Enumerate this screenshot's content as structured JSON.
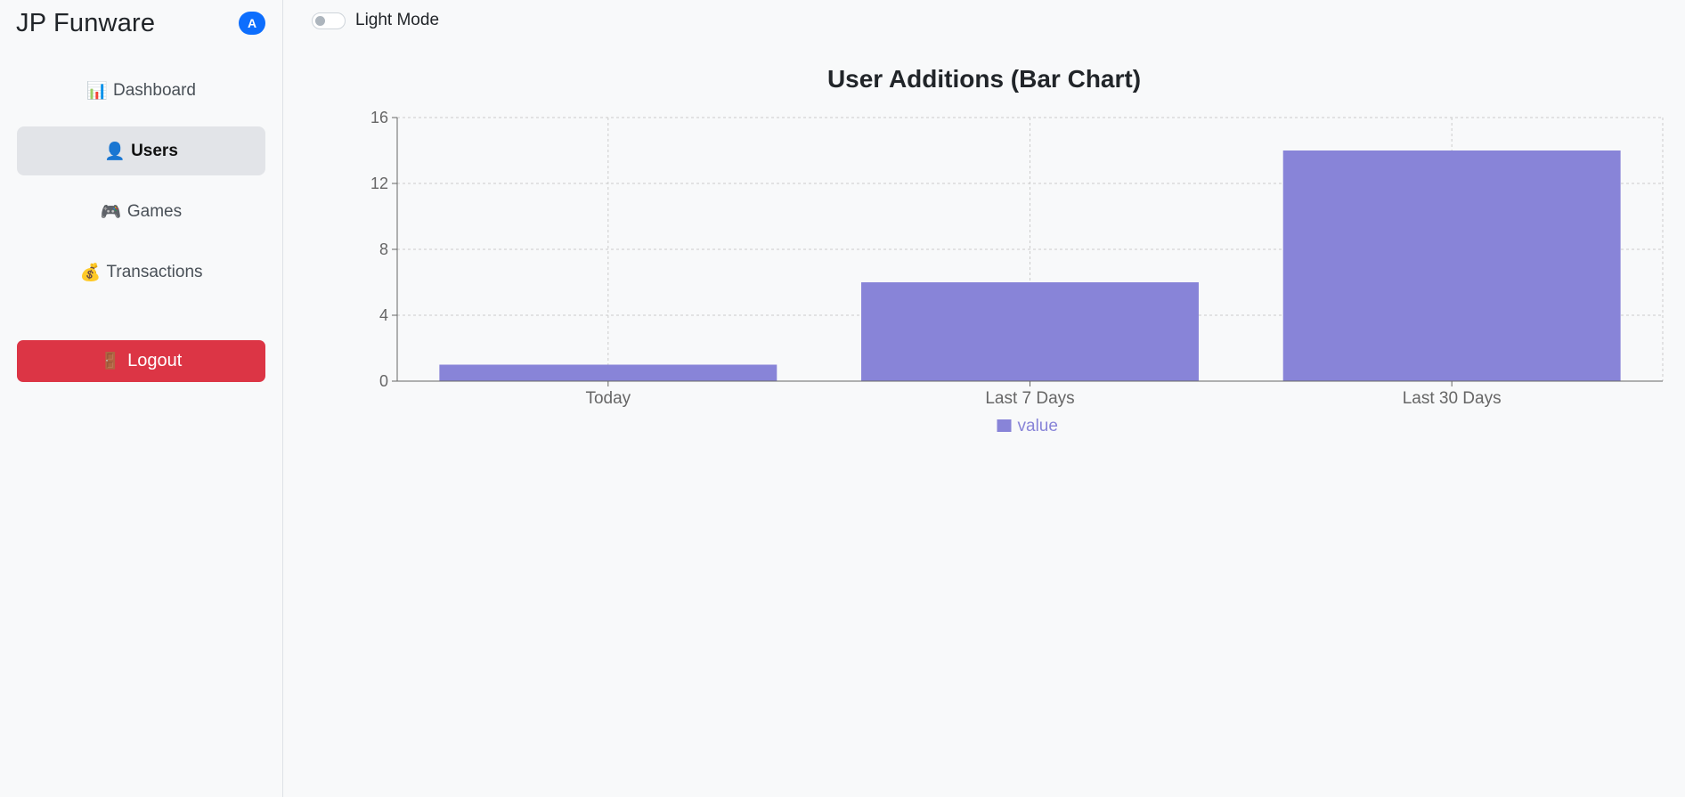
{
  "sidebar": {
    "brand": "JP Funware",
    "avatar_letter": "A",
    "avatar_color": "#0d6efd",
    "items": [
      {
        "icon": "bar-chart-icon",
        "glyph": "📊",
        "label": "Dashboard",
        "active": false
      },
      {
        "icon": "user-icon",
        "glyph": "👤",
        "label": "Users",
        "active": true
      },
      {
        "icon": "gamepad-icon",
        "glyph": "🎮",
        "label": "Games",
        "active": false
      },
      {
        "icon": "money-bag-icon",
        "glyph": "💰",
        "label": "Transactions",
        "active": false
      }
    ],
    "logout": {
      "icon": "door-icon",
      "glyph": "🚪",
      "label": "Logout",
      "color": "#dc3545"
    }
  },
  "header": {
    "theme_toggle_label": "Light Mode",
    "theme_toggle_on": false
  },
  "colors": {
    "bar": "#8884d8",
    "grid": "#cccccc",
    "axis": "#666666"
  },
  "chart_data": {
    "type": "bar",
    "title": "User Additions (Bar Chart)",
    "categories": [
      "Today",
      "Last 7 Days",
      "Last 30 Days"
    ],
    "series": [
      {
        "name": "value",
        "values": [
          1,
          6,
          14
        ]
      }
    ],
    "yticks": [
      0,
      4,
      8,
      12,
      16
    ],
    "ylim": [
      0,
      16
    ],
    "grid": true,
    "legend": "bottom-center"
  }
}
